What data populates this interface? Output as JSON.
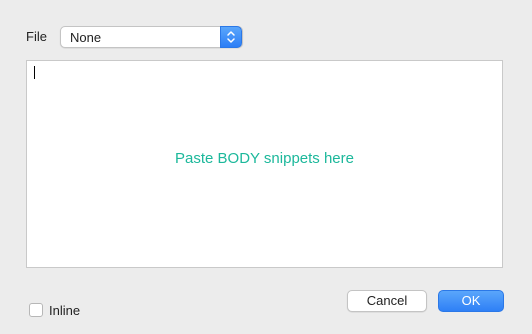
{
  "header": {
    "file_label": "File",
    "file_select_value": "None"
  },
  "editor": {
    "placeholder": "Paste BODY snippets here"
  },
  "footer": {
    "inline_label": "Inline",
    "inline_checked": false,
    "cancel_label": "Cancel",
    "ok_label": "OK"
  },
  "colors": {
    "placeholder_text": "#1cb89b",
    "accent": "#2f80f6",
    "background": "#ececec"
  },
  "icons": {
    "select_stepper": "chevron-up-down-icon"
  }
}
